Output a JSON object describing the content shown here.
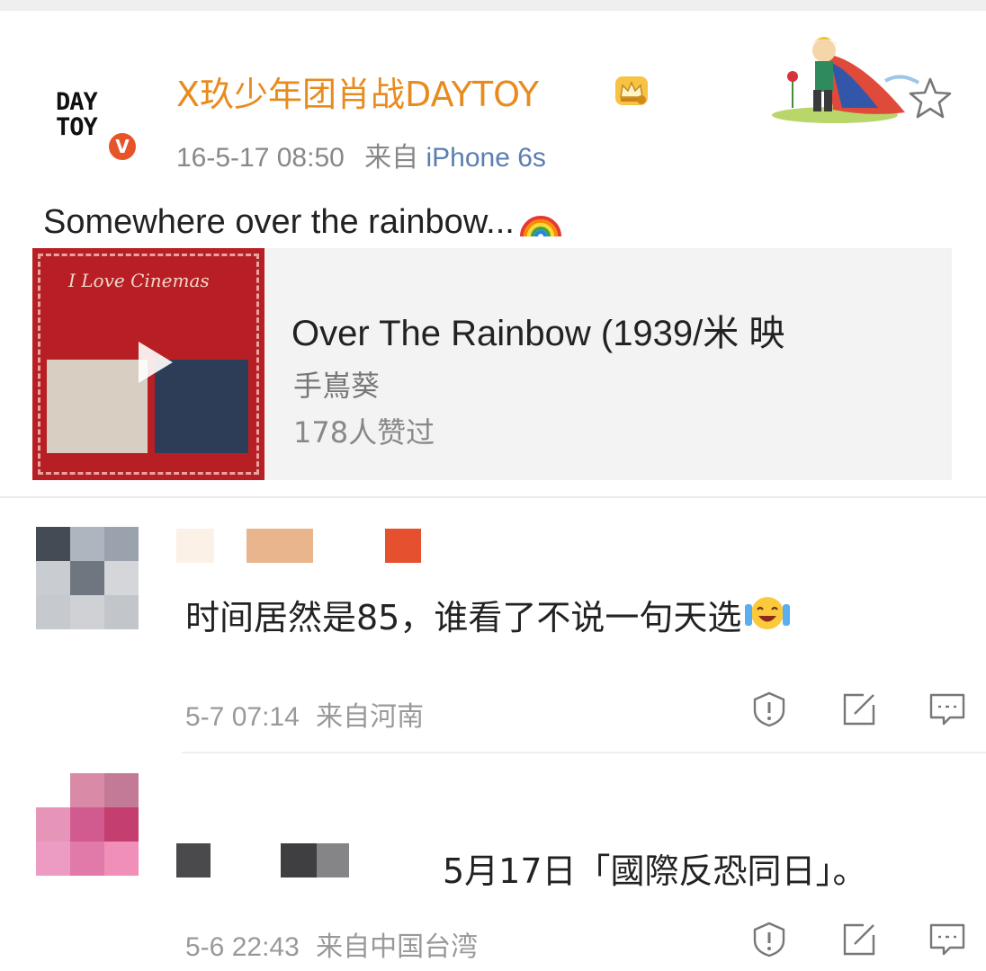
{
  "post": {
    "avatar_logo": "DAY\nTOY",
    "verified_mark": "V",
    "username": "X玖少年团肖战DAYTOY",
    "time": "16-5-17 08:50",
    "source_prefix": "来自",
    "device": "iPhone 6s",
    "text": "Somewhere over the rainbow...",
    "icons": {
      "crown": "crown-icon",
      "star": "star-icon",
      "rainbow": "rainbow-icon",
      "decoration": "little-prince-icon"
    },
    "colors": {
      "username": "#e88b1f",
      "device": "#5a7fb0",
      "verified": "#e8542a"
    }
  },
  "music_card": {
    "album_cover_text": "I Love Cinemas",
    "title": "Over The Rainbow (1939/米 映",
    "artist": "手嶌葵",
    "likes": "178人赞过",
    "play_icon": "play-icon"
  },
  "comments": [
    {
      "text": "时间居然是85，谁看了不说一句天选",
      "time": "5-7 07:14",
      "source": "来自河南",
      "emoji": "laughing-crying-emoji"
    },
    {
      "text": "5月17日「國際反恐同日」。",
      "time": "5-6 22:43",
      "source": "来自中国台湾"
    }
  ],
  "actions": {
    "report_icon": "report-icon",
    "repost_icon": "repost-icon",
    "reply_icon": "reply-icon"
  }
}
